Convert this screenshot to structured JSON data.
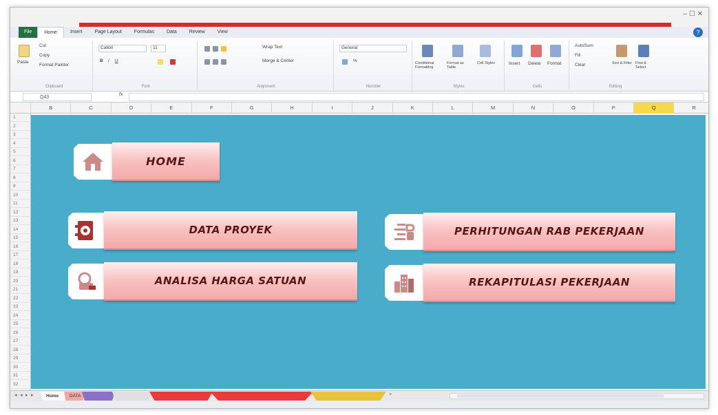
{
  "app": {
    "title": "",
    "window_controls": "– ☐ ✕"
  },
  "ribbon": {
    "tabs": [
      {
        "label": "File",
        "active": false
      },
      {
        "label": "Home",
        "active": true
      },
      {
        "label": "Insert",
        "active": false
      },
      {
        "label": "Page Layout",
        "active": false
      },
      {
        "label": "Formulas",
        "active": false
      },
      {
        "label": "Data",
        "active": false
      },
      {
        "label": "Review",
        "active": false
      },
      {
        "label": "View",
        "active": false
      }
    ],
    "help_icon": "?",
    "groups": {
      "clipboard": {
        "label": "Clipboard",
        "paste": "Paste",
        "cut": "Cut",
        "copy": "Copy",
        "format_painter": "Format Painter"
      },
      "font": {
        "label": "Font",
        "font_name": "Calibri",
        "font_size": "11"
      },
      "alignment": {
        "label": "Alignment",
        "wrap_text": "Wrap Text",
        "merge_center": "Merge & Center"
      },
      "number": {
        "label": "Number",
        "format": "General"
      },
      "styles": {
        "label": "Styles",
        "conditional": "Conditional Formatting",
        "format_table": "Format as Table",
        "cell_styles": "Cell Styles"
      },
      "cells": {
        "label": "Cells",
        "insert": "Insert",
        "delete": "Delete",
        "format": "Format"
      },
      "editing": {
        "label": "Editing",
        "autosum": "AutoSum",
        "fill": "Fill",
        "clear": "Clear",
        "sort_filter": "Sort & Filter",
        "find_select": "Find & Select"
      }
    }
  },
  "formula_bar": {
    "name_box": "Q43",
    "fx": "fx",
    "value": ""
  },
  "columns": [
    "B",
    "C",
    "D",
    "E",
    "F",
    "G",
    "H",
    "I",
    "J",
    "K",
    "L",
    "M",
    "N",
    "O",
    "P",
    "Q",
    "R"
  ],
  "selected_column": "Q",
  "rows": [
    "1",
    "2",
    "3",
    "4",
    "5",
    "6",
    "7",
    "8",
    "9",
    "10",
    "11",
    "12",
    "13",
    "14",
    "15",
    "16",
    "17",
    "18",
    "19",
    "20",
    "21",
    "22",
    "23",
    "24",
    "25",
    "26",
    "27",
    "28",
    "29",
    "30",
    "31",
    "32"
  ],
  "sheet": {
    "background": "#4aaccb",
    "buttons": {
      "home": {
        "label": "HOME",
        "icon": "home-icon"
      },
      "data_proyek": {
        "label": "DATA PROYEK",
        "icon": "document-gear-icon"
      },
      "analisa": {
        "label": "ANALISA HARGA SATUAN",
        "icon": "calculator-hand-icon"
      },
      "perhitungan": {
        "label": "PERHITUNGAN RAB PEKERJAAN",
        "icon": "checklist-icon"
      },
      "rekapitulasi": {
        "label": "REKAPITULASI PEKERJAAN",
        "icon": "building-icon"
      }
    }
  },
  "sheet_tabs": [
    {
      "label": "Home",
      "color": "#ffffff"
    },
    {
      "label": "DATA",
      "color": "#f4a6a6"
    },
    {
      "label": "",
      "color": "#8b6fc9"
    },
    {
      "label": "",
      "color": "#e0e0e0"
    },
    {
      "label": "",
      "color": "#e83b3b"
    },
    {
      "label": "",
      "color": "#e83b3b"
    },
    {
      "label": "",
      "color": "#e8c23b"
    }
  ]
}
